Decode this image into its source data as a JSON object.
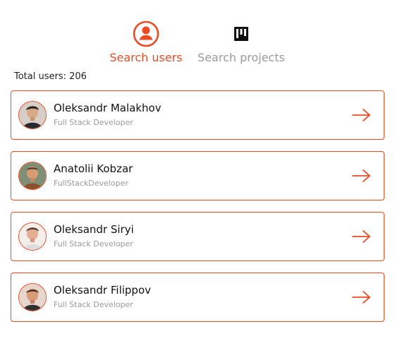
{
  "colors": {
    "accent": "#ea4b23",
    "muted": "#9a9a9a",
    "text": "#111111"
  },
  "tabs": [
    {
      "label": "Search users",
      "icon": "user-circle-icon",
      "active": true
    },
    {
      "label": "Search projects",
      "icon": "kanban-board-icon",
      "active": false
    }
  ],
  "summary": {
    "total_users": "Total users: 206"
  },
  "users": [
    {
      "name": "Oleksandr Malakhov",
      "role": "Full Stack Developer",
      "avatar_icon": "profile-photo-icon"
    },
    {
      "name": "Anatolii Kobzar",
      "role": "FullStackDeveloper",
      "avatar_icon": "profile-photo-icon"
    },
    {
      "name": "Oleksandr Siryi",
      "role": "Full Stack Developer",
      "avatar_icon": "profile-photo-icon"
    },
    {
      "name": "Oleksandr Filippov",
      "role": "Full Stack Developer",
      "avatar_icon": "profile-photo-icon"
    }
  ],
  "row_action_icon": "arrow-right-icon"
}
